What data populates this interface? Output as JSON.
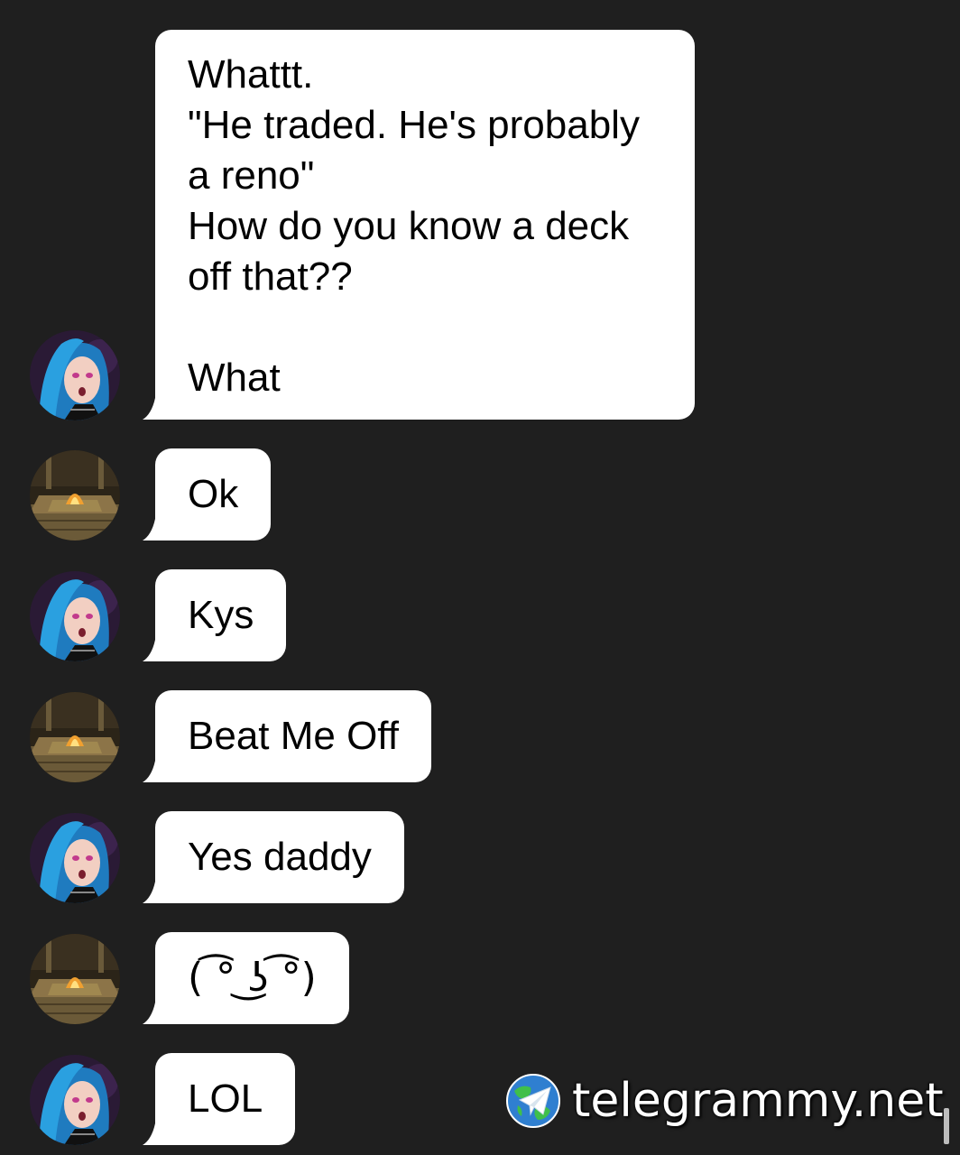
{
  "messages": [
    {
      "sender": "jinx",
      "text": "Whattt.\n\"He traded. He's probably a reno\"\nHow do you know a deck off that??\n\nWhat"
    },
    {
      "sender": "tavern",
      "text": "Ok"
    },
    {
      "sender": "jinx",
      "text": "Kys"
    },
    {
      "sender": "tavern",
      "text": "Beat Me Off"
    },
    {
      "sender": "jinx",
      "text": "Yes daddy"
    },
    {
      "sender": "tavern",
      "text": "( ͡° ͜ʖ ͡°)"
    },
    {
      "sender": "jinx",
      "text": "LOL"
    }
  ],
  "watermark": {
    "text": "telegrammy.net",
    "icon": "telegram-globe-icon"
  },
  "colors": {
    "background": "#1f1f1f",
    "bubble": "#ffffff",
    "text": "#000000"
  }
}
